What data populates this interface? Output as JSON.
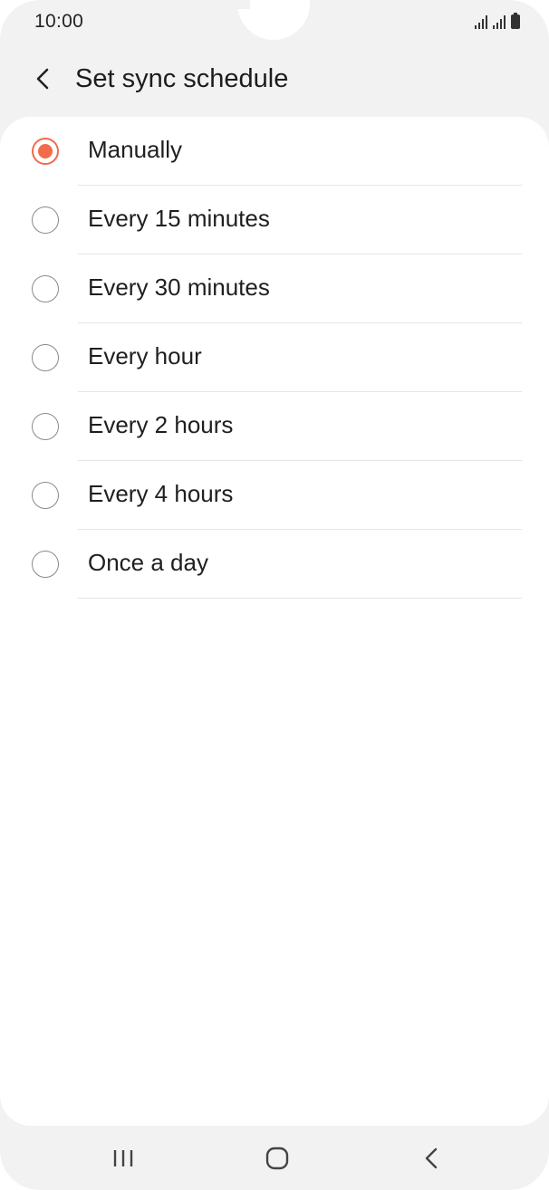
{
  "status_bar": {
    "time": "10:00",
    "icons": [
      "signal-icon",
      "signal-icon",
      "battery-icon"
    ]
  },
  "app_bar": {
    "back_icon": "chevron-left-icon",
    "title": "Set sync schedule"
  },
  "options": [
    {
      "label": "Manually",
      "selected": true
    },
    {
      "label": "Every 15 minutes",
      "selected": false
    },
    {
      "label": "Every 30 minutes",
      "selected": false
    },
    {
      "label": "Every hour",
      "selected": false
    },
    {
      "label": "Every 2 hours",
      "selected": false
    },
    {
      "label": "Every 4 hours",
      "selected": false
    },
    {
      "label": "Once a day",
      "selected": false
    }
  ],
  "nav_bar": {
    "icons": [
      "recents-icon",
      "home-icon",
      "back-icon"
    ]
  },
  "colors": {
    "accent": "#f26b4b",
    "background": "#f2f2f2",
    "card": "#ffffff"
  }
}
